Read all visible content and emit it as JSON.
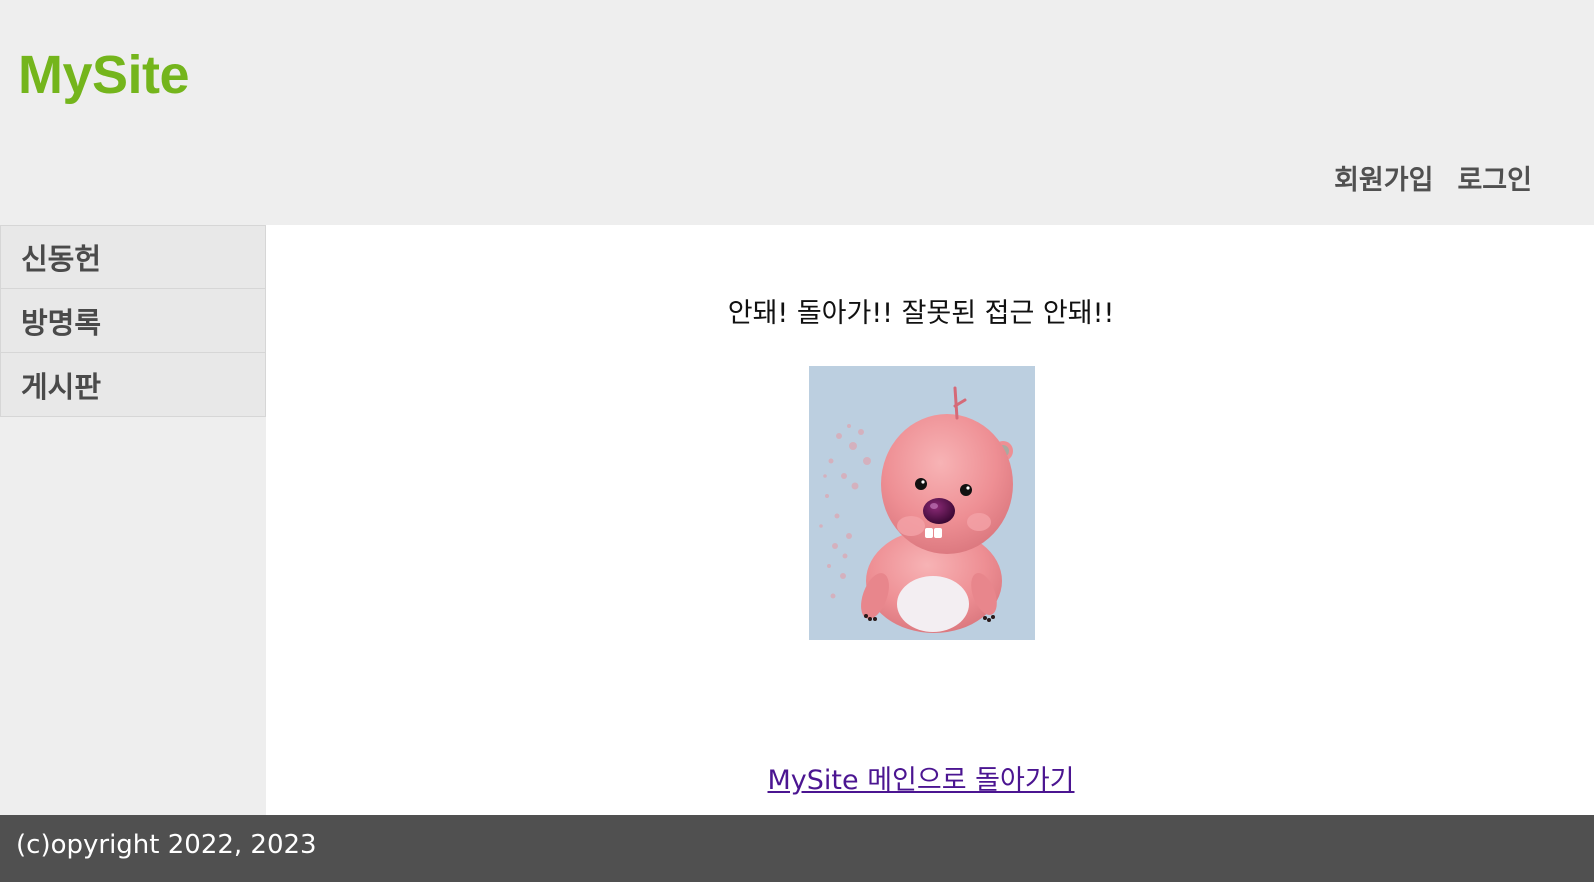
{
  "header": {
    "logo": "MySite",
    "nav": {
      "join_label": "회원가입",
      "login_label": "로그인"
    }
  },
  "sidebar": {
    "items": [
      {
        "label": "신동헌"
      },
      {
        "label": "방명록"
      },
      {
        "label": "게시판"
      }
    ]
  },
  "main": {
    "message": "안돼! 돌아가!! 잘못된 접근 안돼!!",
    "image": {
      "icon": "pink-beaver-character-image"
    },
    "home_link": "MySite 메인으로 돌아가기"
  },
  "footer": {
    "copyright": "(c)opyright 2022, 2023"
  },
  "colors": {
    "logo": "#74b51c",
    "header_bg": "#eeeeee",
    "footer_bg": "#505050",
    "link": "#4b1591"
  }
}
